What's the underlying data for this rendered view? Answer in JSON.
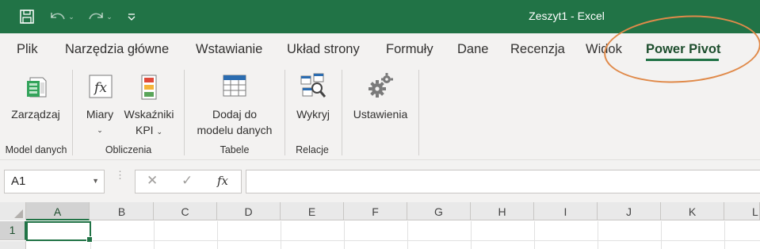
{
  "window": {
    "title": "Zeszyt1",
    "separator": "-",
    "app": "Excel"
  },
  "colors": {
    "title_bar": "#217346",
    "active_tab": "#217346",
    "annotation": "#e08a4a"
  },
  "qat": {
    "icons": [
      "save-icon",
      "undo-icon",
      "redo-icon",
      "customize-qat-icon"
    ]
  },
  "tabs": [
    {
      "label": "Plik"
    },
    {
      "label": "Narzędzia główne"
    },
    {
      "label": "Wstawianie"
    },
    {
      "label": "Układ strony"
    },
    {
      "label": "Formuły"
    },
    {
      "label": "Dane"
    },
    {
      "label": "Recenzja"
    },
    {
      "label": "Widok"
    },
    {
      "label": "Power Pivot",
      "active": true
    }
  ],
  "ribbon": {
    "groups": [
      {
        "label": "Model danych",
        "buttons": [
          {
            "label": "Zarządzaj",
            "icon": "data-model-icon"
          }
        ]
      },
      {
        "label": "Obliczenia",
        "buttons": [
          {
            "label": "Miary",
            "icon": "fx-icon",
            "dropdown": true
          },
          {
            "label": "Wskaźniki KPI",
            "line1": "Wskaźniki",
            "line2": "KPI",
            "icon": "kpi-icon",
            "dropdown": true
          }
        ]
      },
      {
        "label": "Tabele",
        "buttons": [
          {
            "label": "Dodaj do modelu danych",
            "line1": "Dodaj do",
            "line2": "modelu danych",
            "icon": "table-icon"
          }
        ]
      },
      {
        "label": "Relacje",
        "buttons": [
          {
            "label": "Wykryj",
            "icon": "detect-icon"
          }
        ]
      },
      {
        "label": "",
        "buttons": [
          {
            "label": "Ustawienia",
            "icon": "gears-icon"
          }
        ]
      }
    ]
  },
  "formula_bar": {
    "name_box": "A1",
    "fx": "fx",
    "formula": ""
  },
  "grid": {
    "columns": [
      "A",
      "B",
      "C",
      "D",
      "E",
      "F",
      "G",
      "H",
      "I",
      "J",
      "K",
      "L"
    ],
    "rows": [
      "1"
    ],
    "selected_cell": "A1"
  }
}
